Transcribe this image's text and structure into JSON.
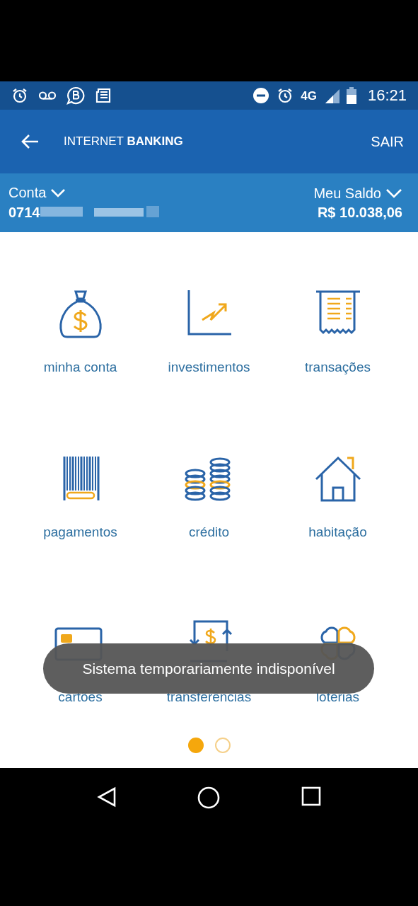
{
  "status_bar": {
    "network": "4G",
    "time": "16:21"
  },
  "header": {
    "title_light": "INTERNET",
    "title_bold": "BANKING",
    "logout": "SAIR"
  },
  "account": {
    "label": "Conta",
    "number": "0714",
    "balance_label": "Meu Saldo",
    "balance": "R$ 10.038,06"
  },
  "menu": [
    {
      "label": "minha conta"
    },
    {
      "label": "investimentos"
    },
    {
      "label": "transações"
    },
    {
      "label": "pagamentos"
    },
    {
      "label": "crédito"
    },
    {
      "label": "habitação"
    },
    {
      "label": "cartões"
    },
    {
      "label": "transferências"
    },
    {
      "label": "loterias"
    }
  ],
  "toast": {
    "text": "Sistema temporariamente indisponível"
  },
  "pager": [
    {
      "selected": true
    },
    {
      "selected": false
    }
  ]
}
